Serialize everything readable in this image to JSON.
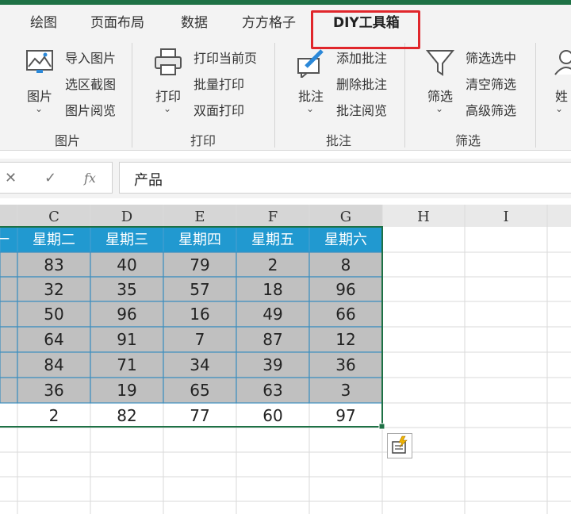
{
  "ribbon_tabs": [
    "绘图",
    "页面布局",
    "数据",
    "方方格子",
    "DIY工具箱"
  ],
  "active_tab": "DIY工具箱",
  "groups": {
    "picture": {
      "label": "图片",
      "main_button": "图片",
      "buttons": [
        "导入图片",
        "选区截图",
        "图片阅览"
      ]
    },
    "print": {
      "label": "打印",
      "main_button": "打印",
      "buttons": [
        "打印当前页",
        "批量打印",
        "双面打印"
      ]
    },
    "comment": {
      "label": "批注",
      "main_button": "批注",
      "buttons": [
        "添加批注",
        "删除批注",
        "批注阅览"
      ]
    },
    "filter": {
      "label": "筛选",
      "main_button": "筛选",
      "buttons": [
        "筛选选中",
        "清空筛选",
        "高级筛选"
      ]
    },
    "partial": {
      "main_button": "姓"
    }
  },
  "formula_bar": {
    "cancel": "✕",
    "confirm": "✓",
    "fx": "fx",
    "content": "产品"
  },
  "sheet": {
    "columns": [
      "C",
      "D",
      "E",
      "F",
      "G",
      "H",
      "I"
    ],
    "table": {
      "headers": [
        "一",
        "星期二",
        "星期三",
        "星期四",
        "星期五",
        "星期六"
      ],
      "rows": [
        [
          "",
          83,
          40,
          79,
          2,
          8
        ],
        [
          "",
          32,
          35,
          57,
          18,
          96
        ],
        [
          "",
          50,
          96,
          16,
          49,
          66
        ],
        [
          "",
          64,
          91,
          7,
          87,
          12
        ],
        [
          "",
          84,
          71,
          34,
          39,
          36
        ],
        [
          "",
          36,
          19,
          65,
          63,
          3
        ],
        [
          "",
          2,
          82,
          77,
          60,
          97
        ]
      ]
    }
  },
  "colors": {
    "header_fill": "#2199d0",
    "header_text": "#ffffff",
    "data_fill": "#c0c0c0",
    "selection": "#1e7145",
    "accent": "#1e7145",
    "highlight_box": "#e0262b"
  },
  "floating_icon": "quick-analysis-icon"
}
